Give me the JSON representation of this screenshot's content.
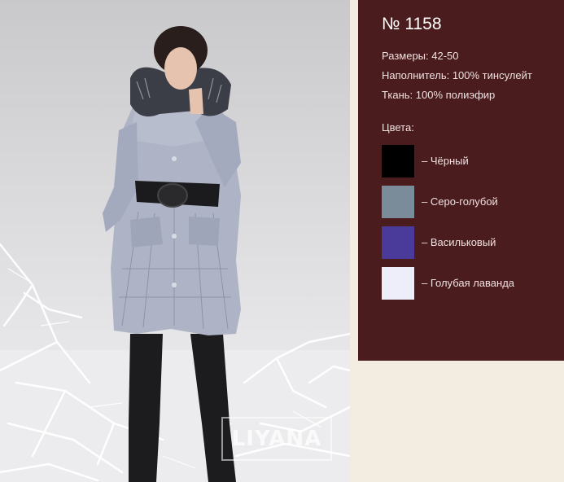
{
  "product": {
    "number": "№ 1158",
    "sizes": "Размеры: 42-50",
    "filler": "Наполнитель: 100% тинсулейт",
    "fabric": "Ткань: 100% полиэфир"
  },
  "colors_label": "Цвета:",
  "colors": [
    {
      "label": "– Чёрный",
      "hex": "#000000"
    },
    {
      "label": "– Серо-голубой",
      "hex": "#7a8b99"
    },
    {
      "label": "– Васильковый",
      "hex": "#4a3a9a"
    },
    {
      "label": "– Голубая лаванда",
      "hex": "#eeeefb"
    }
  ],
  "watermark": "LIYANA",
  "theme": {
    "panel": "#4b1c1e",
    "background": "#f3ece0"
  }
}
